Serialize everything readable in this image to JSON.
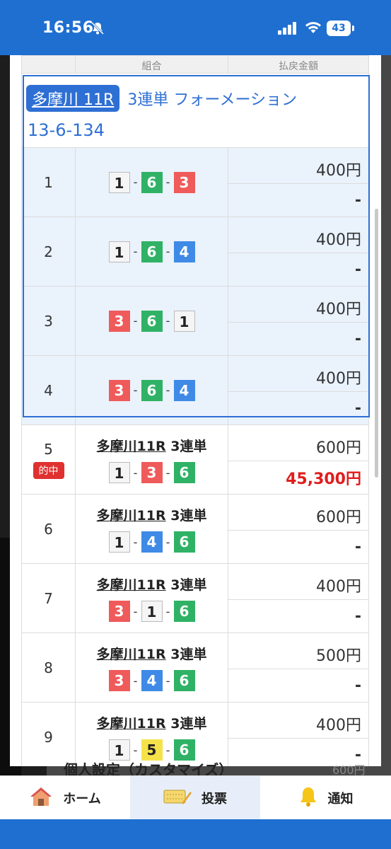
{
  "status": {
    "time": "16:56",
    "battery": "43"
  },
  "header_row": {
    "col2": "組合",
    "col3": "払戻金額"
  },
  "formation": {
    "venue": "多摩川 11R",
    "bet_type": "3連単 フォーメーション",
    "combo": "13-6-134",
    "rows": [
      {
        "no": "1",
        "boats": [
          "1",
          "6",
          "3"
        ],
        "amount": "400円",
        "payout": "-"
      },
      {
        "no": "2",
        "boats": [
          "1",
          "6",
          "4"
        ],
        "amount": "400円",
        "payout": "-"
      },
      {
        "no": "3",
        "boats": [
          "3",
          "6",
          "1"
        ],
        "amount": "400円",
        "payout": "-"
      },
      {
        "no": "4",
        "boats": [
          "3",
          "6",
          "4"
        ],
        "amount": "400円",
        "payout": "-"
      }
    ]
  },
  "bets": [
    {
      "no": "5",
      "race": "多摩川11R",
      "type": "3連単",
      "boats": [
        "1",
        "3",
        "6"
      ],
      "amount": "600円",
      "payout": "45,300円",
      "hit": "的中"
    },
    {
      "no": "6",
      "race": "多摩川11R",
      "type": "3連単",
      "boats": [
        "1",
        "4",
        "6"
      ],
      "amount": "600円",
      "payout": "-"
    },
    {
      "no": "7",
      "race": "多摩川11R",
      "type": "3連単",
      "boats": [
        "3",
        "1",
        "6"
      ],
      "amount": "400円",
      "payout": "-"
    },
    {
      "no": "8",
      "race": "多摩川11R",
      "type": "3連単",
      "boats": [
        "3",
        "4",
        "6"
      ],
      "amount": "500円",
      "payout": "-"
    },
    {
      "no": "9",
      "race": "多摩川11R",
      "type": "3連単",
      "boats": [
        "1",
        "5",
        "6"
      ],
      "amount": "400円",
      "payout": "-"
    }
  ],
  "background": {
    "footer_text": "個人設定（カスタマイズ）",
    "footer_amount": "600円"
  },
  "nav": {
    "home": "ホーム",
    "vote": "投票",
    "notify": "通知"
  },
  "colors": {
    "accent": "#1f6fd1",
    "boat1": "#f5f5f5",
    "boat3": "#ef5a5a",
    "boat4": "#3f8ae6",
    "boat5": "#f5e24a",
    "boat6": "#2fb265",
    "hit": "#e01e1e"
  }
}
